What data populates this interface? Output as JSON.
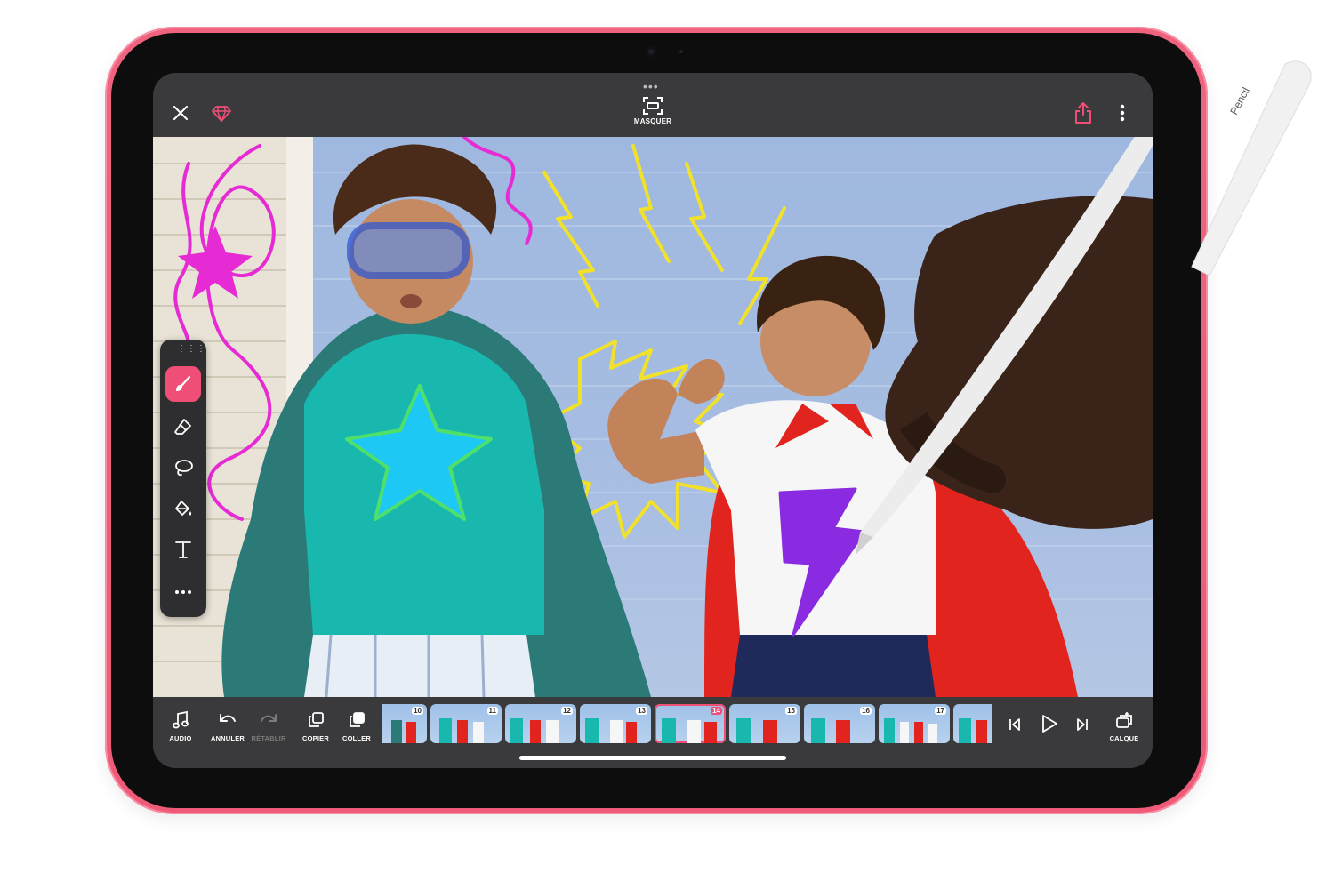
{
  "topbar": {
    "mask_label": "MASQUER"
  },
  "toolbar": {
    "tools": [
      "brush",
      "eraser",
      "lasso",
      "fill",
      "text",
      "more"
    ],
    "active_tool": "brush",
    "accent_color": "#ef4f77"
  },
  "bottombar": {
    "audio_label": "AUDIO",
    "undo_label": "ANNULER",
    "redo_label": "RÉTABLIR",
    "copy_label": "COPIER",
    "paste_label": "COLLER",
    "layer_label": "CALQUE",
    "frames": [
      "10",
      "11",
      "12",
      "13",
      "14",
      "15",
      "16",
      "17"
    ],
    "current_frame": "14"
  },
  "stylus": {
    "brand_text": "Pencil"
  },
  "colors": {
    "device": "#ee5a77",
    "ui_background": "#3a3a3c",
    "doodle_magenta": "#e62bd4",
    "doodle_yellow": "#f1e12a",
    "doodle_purple": "#8a2be2"
  }
}
